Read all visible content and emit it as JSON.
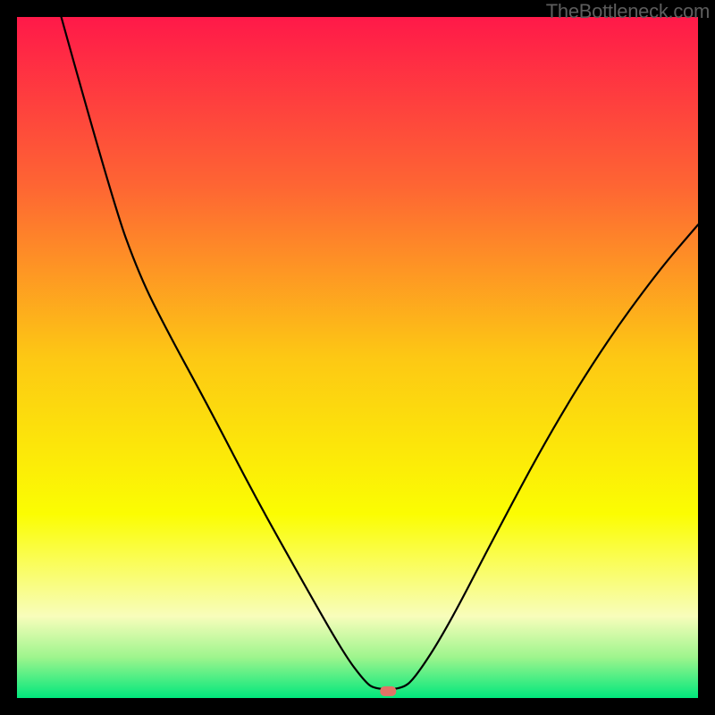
{
  "watermark": "TheBottleneck.com",
  "chart_data": {
    "type": "line",
    "title": "",
    "xlabel": "",
    "ylabel": "",
    "xlim": [
      0,
      100
    ],
    "ylim": [
      0,
      100
    ],
    "grid": false,
    "legend": false,
    "background_gradient_stops": [
      {
        "offset": 0.0,
        "color": "#ff1949"
      },
      {
        "offset": 0.25,
        "color": "#fe6633"
      },
      {
        "offset": 0.5,
        "color": "#fdc814"
      },
      {
        "offset": 0.73,
        "color": "#fbfd02"
      },
      {
        "offset": 0.88,
        "color": "#f8fdbb"
      },
      {
        "offset": 0.94,
        "color": "#9ef58d"
      },
      {
        "offset": 1.0,
        "color": "#00e77c"
      }
    ],
    "marker": {
      "x_pct": 54.5,
      "y_pct": 99.0,
      "color": "#e27366"
    },
    "series": [
      {
        "name": "curve",
        "color": "#000000",
        "points": [
          {
            "x_pct": 6.5,
            "y_pct": 0.0
          },
          {
            "x_pct": 14.0,
            "y_pct": 27.0
          },
          {
            "x_pct": 18.0,
            "y_pct": 38.0
          },
          {
            "x_pct": 22.0,
            "y_pct": 46.0
          },
          {
            "x_pct": 28.0,
            "y_pct": 57.0
          },
          {
            "x_pct": 35.0,
            "y_pct": 70.5
          },
          {
            "x_pct": 42.0,
            "y_pct": 83.0
          },
          {
            "x_pct": 48.0,
            "y_pct": 93.5
          },
          {
            "x_pct": 51.0,
            "y_pct": 97.5
          },
          {
            "x_pct": 52.5,
            "y_pct": 98.7
          },
          {
            "x_pct": 56.5,
            "y_pct": 98.7
          },
          {
            "x_pct": 58.5,
            "y_pct": 97.0
          },
          {
            "x_pct": 63.0,
            "y_pct": 90.0
          },
          {
            "x_pct": 70.0,
            "y_pct": 76.5
          },
          {
            "x_pct": 78.0,
            "y_pct": 61.5
          },
          {
            "x_pct": 86.0,
            "y_pct": 48.5
          },
          {
            "x_pct": 94.0,
            "y_pct": 37.5
          },
          {
            "x_pct": 100.0,
            "y_pct": 30.5
          }
        ]
      }
    ]
  }
}
